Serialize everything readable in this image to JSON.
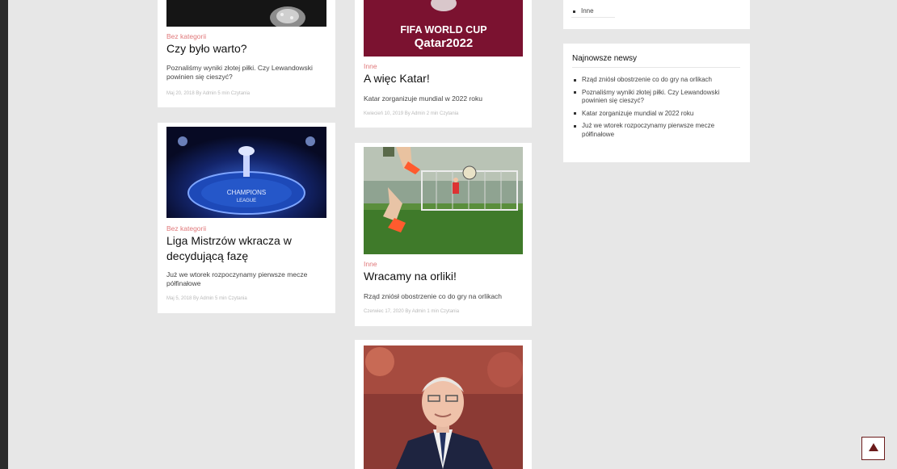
{
  "posts": [
    {
      "category": "Bez kategorii",
      "title": "Czy było warto?",
      "excerpt": "Poznaliśmy wyniki złotej piłki. Czy Lewandowski powinien się cieszyć?",
      "meta": "Maj 20, 2018 By Admin 5 min Czytania"
    },
    {
      "image_text": [
        "FIFA WORLD CUP",
        "Qatar2022"
      ],
      "category": "Inne",
      "title": "A więc Katar!",
      "excerpt": "Katar zorganizuje mundial w 2022 roku",
      "meta": "Kwiecień 10, 2019 By Admin 2 min Czytania"
    },
    {
      "image_text": [
        "CHAMPIONS",
        "LEAGUE"
      ],
      "category": "Bez kategorii",
      "title": "Liga Mistrzów wkracza w decydującą fazę",
      "excerpt": "Już we wtorek rozpoczynamy pierwsze mecze półfinałowe",
      "meta": "Maj 5, 2018 By Admin 5 min Czytania"
    },
    {
      "category": "Inne",
      "title": "Wracamy na orliki!",
      "excerpt": "Rząd zniósł obostrzenie co do gry na orlikach",
      "meta": "Czerwiec 17, 2020 By Admin 1 min Czytania"
    }
  ],
  "sidebar": {
    "categories_tail": "Inne",
    "latest_title": "Najnowsze newsy",
    "latest": [
      "Rząd zniósł obostrzenie co do gry na orlikach",
      "Poznaliśmy wyniki złotej piłki. Czy Lewandowski powinien się cieszyć?",
      "Katar zorganizuje mundial w 2022 roku",
      "Już we wtorek rozpoczynamy pierwsze mecze półfinałowe"
    ]
  },
  "colors": {
    "accent": "#e0787a",
    "qatar": "#7b1230",
    "scroll_button_border": "#6b1b1b"
  },
  "icons": {
    "scroll_top": "triangle-up-icon"
  }
}
